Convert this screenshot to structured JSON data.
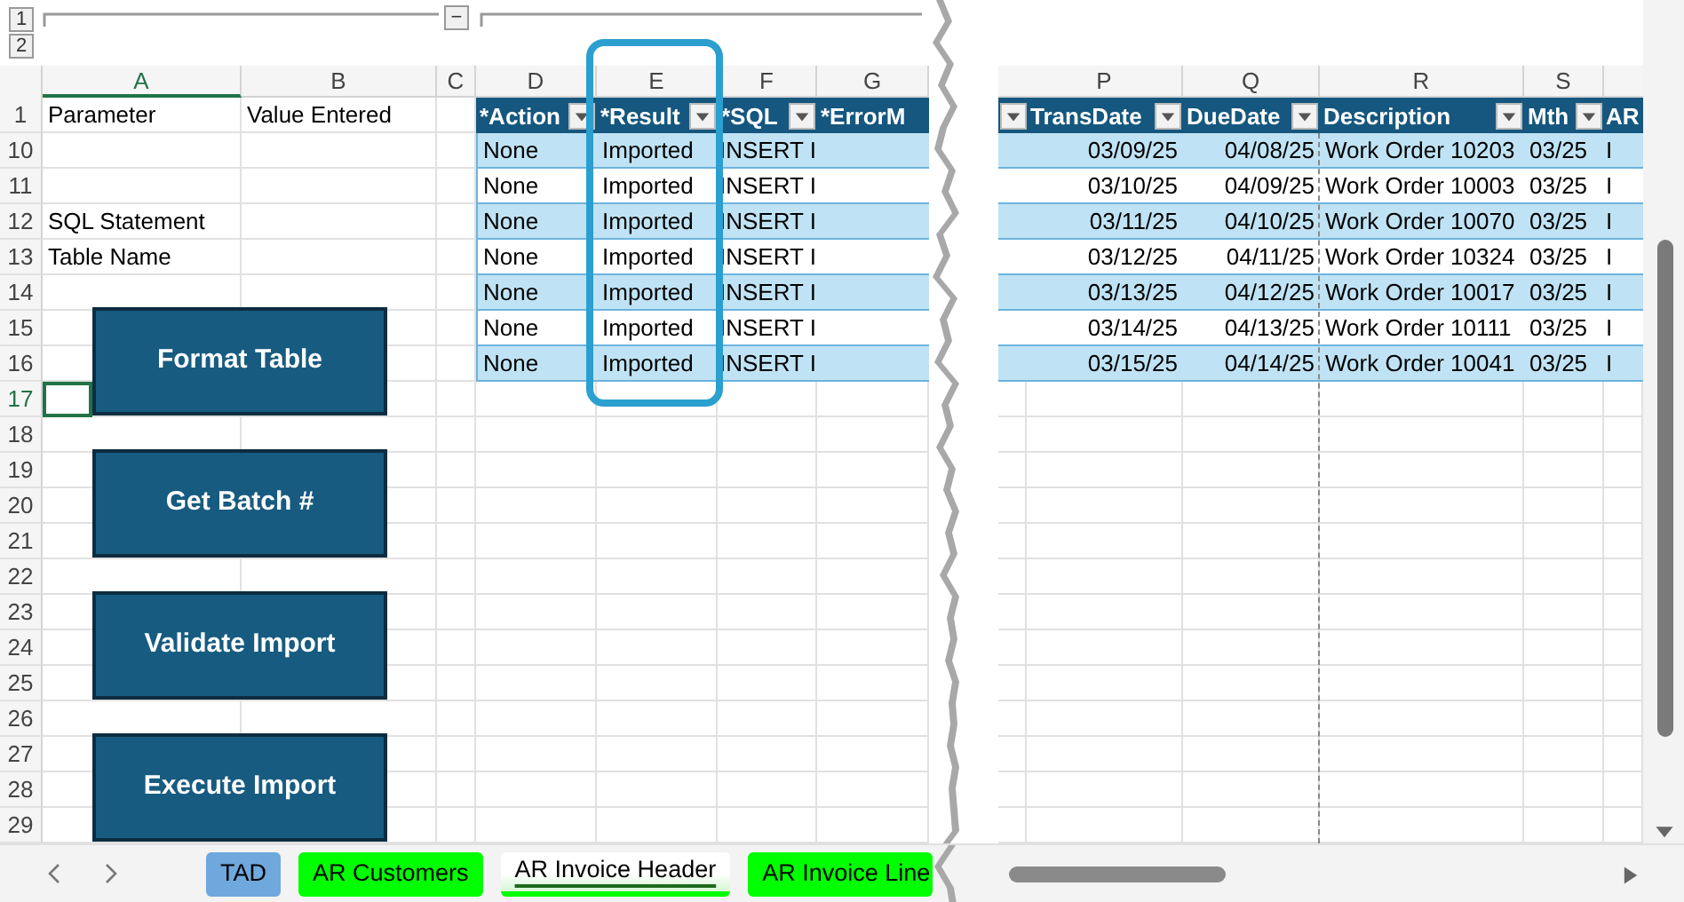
{
  "outline": {
    "levels": [
      "1",
      "2"
    ],
    "collapse_button": "−"
  },
  "left_columns": [
    {
      "letter": "A",
      "selected": true
    },
    {
      "letter": "B",
      "selected": false
    },
    {
      "letter": "C",
      "selected": false
    },
    {
      "letter": "D",
      "selected": false
    },
    {
      "letter": "E",
      "selected": false
    },
    {
      "letter": "F",
      "selected": false
    },
    {
      "letter": "G",
      "selected": false
    }
  ],
  "right_columns": [
    {
      "letter": "P",
      "selected": false
    },
    {
      "letter": "Q",
      "selected": false
    },
    {
      "letter": "R",
      "selected": false
    },
    {
      "letter": "S",
      "selected": false
    }
  ],
  "rows": [
    {
      "number": "1",
      "selected": false,
      "column_a": "Parameter",
      "column_b": "Value Entered"
    },
    {
      "number": "10",
      "selected": false
    },
    {
      "number": "11",
      "selected": false
    },
    {
      "number": "12",
      "selected": false,
      "column_a": "SQL Statement"
    },
    {
      "number": "13",
      "selected": false,
      "column_a": "Table Name"
    },
    {
      "number": "14",
      "selected": false
    },
    {
      "number": "15",
      "selected": false
    },
    {
      "number": "16",
      "selected": false
    },
    {
      "number": "17",
      "selected": true
    },
    {
      "number": "18",
      "selected": false
    },
    {
      "number": "19",
      "selected": false
    },
    {
      "number": "20",
      "selected": false
    },
    {
      "number": "21",
      "selected": false
    },
    {
      "number": "22",
      "selected": false
    },
    {
      "number": "23",
      "selected": false
    },
    {
      "number": "24",
      "selected": false
    },
    {
      "number": "25",
      "selected": false
    },
    {
      "number": "26",
      "selected": false
    },
    {
      "number": "27",
      "selected": false
    },
    {
      "number": "28",
      "selected": false
    },
    {
      "number": "29",
      "selected": false
    }
  ],
  "left_table": {
    "headers": [
      "*Action",
      "*Result",
      "*SQL",
      "*ErrorM"
    ],
    "rows": [
      {
        "cells": [
          "None",
          "Imported",
          "INSERT I"
        ]
      },
      {
        "cells": [
          "None",
          "Imported",
          "INSERT I"
        ]
      },
      {
        "cells": [
          "None",
          "Imported",
          "INSERT I"
        ]
      },
      {
        "cells": [
          "None",
          "Imported",
          "INSERT I"
        ]
      },
      {
        "cells": [
          "None",
          "Imported",
          "INSERT I"
        ]
      },
      {
        "cells": [
          "None",
          "Imported",
          "INSERT I"
        ]
      },
      {
        "cells": [
          "None",
          "Imported",
          "INSERT I"
        ]
      }
    ]
  },
  "right_table": {
    "headers": [
      "TransDate",
      "DueDate",
      "Description",
      "Mth",
      "AR"
    ],
    "rows": [
      {
        "cells": [
          "03/09/25",
          "04/08/25",
          "Work Order 10203",
          "03/25",
          "I"
        ]
      },
      {
        "cells": [
          "03/10/25",
          "04/09/25",
          "Work Order 10003",
          "03/25",
          "I"
        ]
      },
      {
        "cells": [
          "03/11/25",
          "04/10/25",
          "Work Order 10070",
          "03/25",
          "I"
        ]
      },
      {
        "cells": [
          "03/12/25",
          "04/11/25",
          "Work Order 10324",
          "03/25",
          "I"
        ]
      },
      {
        "cells": [
          "03/13/25",
          "04/12/25",
          "Work Order 10017",
          "03/25",
          "I"
        ]
      },
      {
        "cells": [
          "03/14/25",
          "04/13/25",
          "Work Order 10111",
          "03/25",
          "I"
        ]
      },
      {
        "cells": [
          "03/15/25",
          "04/14/25",
          "Work Order 10041",
          "03/25",
          "I"
        ]
      }
    ]
  },
  "buttons": [
    "Format Table",
    "Get Batch #",
    "Validate Import",
    "Execute Import"
  ],
  "sheet_tabs": [
    {
      "label": "TAD",
      "color": "#6fa8dc",
      "selected": false
    },
    {
      "label": "AR Customers",
      "color": "#00ff00",
      "selected": false
    },
    {
      "label": "AR Invoice Header",
      "color": "#00ff00",
      "selected": true
    },
    {
      "label": "AR Invoice Line",
      "color": "#00ff00",
      "selected": false
    }
  ]
}
